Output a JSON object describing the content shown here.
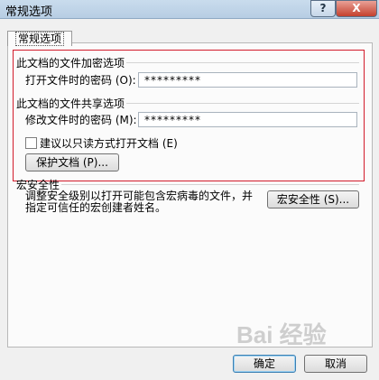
{
  "window": {
    "title": "常规选项",
    "help_label": "?",
    "close_label": "X"
  },
  "tab": {
    "label": "常规选项"
  },
  "encryption_group": {
    "title": "此文档的文件加密选项",
    "open_password_label": "打开文件时的密码 (O):",
    "open_password_value": "*********"
  },
  "sharing_group": {
    "title": "此文档的文件共享选项",
    "modify_password_label": "修改文件时的密码 (M):",
    "modify_password_value": "*********",
    "readonly_label": "建议以只读方式打开文档 (E)",
    "readonly_checked": false,
    "protect_button": "保护文档 (P)..."
  },
  "macro_security": {
    "title": "宏安全性",
    "description": "调整安全级别以打开可能包含宏病毒的文件，并指定可信任的宏创建者姓名。",
    "button": "宏安全性 (S)..."
  },
  "footer": {
    "ok": "确定",
    "cancel": "取消"
  },
  "watermark_text": "Bai 经验"
}
